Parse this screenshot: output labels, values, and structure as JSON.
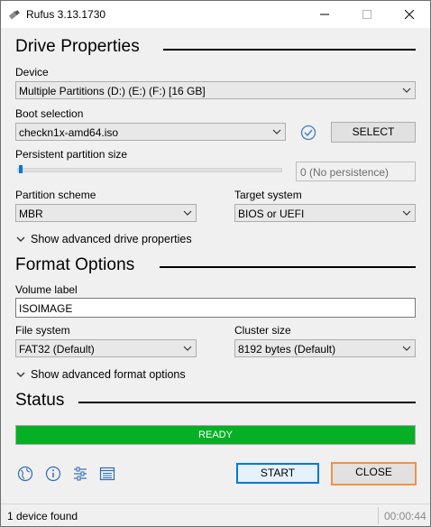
{
  "window": {
    "title": "Rufus 3.13.1730"
  },
  "drive_properties": {
    "title": "Drive Properties",
    "device_label": "Device",
    "device_value": "Multiple Partitions (D:) (E:) (F:) [16 GB]",
    "boot_label": "Boot selection",
    "boot_value": "checkn1x-amd64.iso",
    "select_button": "SELECT",
    "persistent_label": "Persistent partition size",
    "persistent_value": "0 (No persistence)",
    "partition_label": "Partition scheme",
    "partition_value": "MBR",
    "target_label": "Target system",
    "target_value": "BIOS or UEFI",
    "advanced": "Show advanced drive properties"
  },
  "format_options": {
    "title": "Format Options",
    "volume_label": "Volume label",
    "volume_value": "ISOIMAGE",
    "fs_label": "File system",
    "fs_value": "FAT32 (Default)",
    "cluster_label": "Cluster size",
    "cluster_value": "8192 bytes (Default)",
    "advanced": "Show advanced format options"
  },
  "status": {
    "title": "Status",
    "progress_text": "READY",
    "progress_fraction": 1.0
  },
  "actions": {
    "start": "START",
    "close": "CLOSE"
  },
  "statusbar": {
    "text": "1 device found",
    "time": "00:00:44"
  },
  "colors": {
    "progress": "#06b025",
    "accent": "#0078d7",
    "focus": "#f0914a"
  }
}
